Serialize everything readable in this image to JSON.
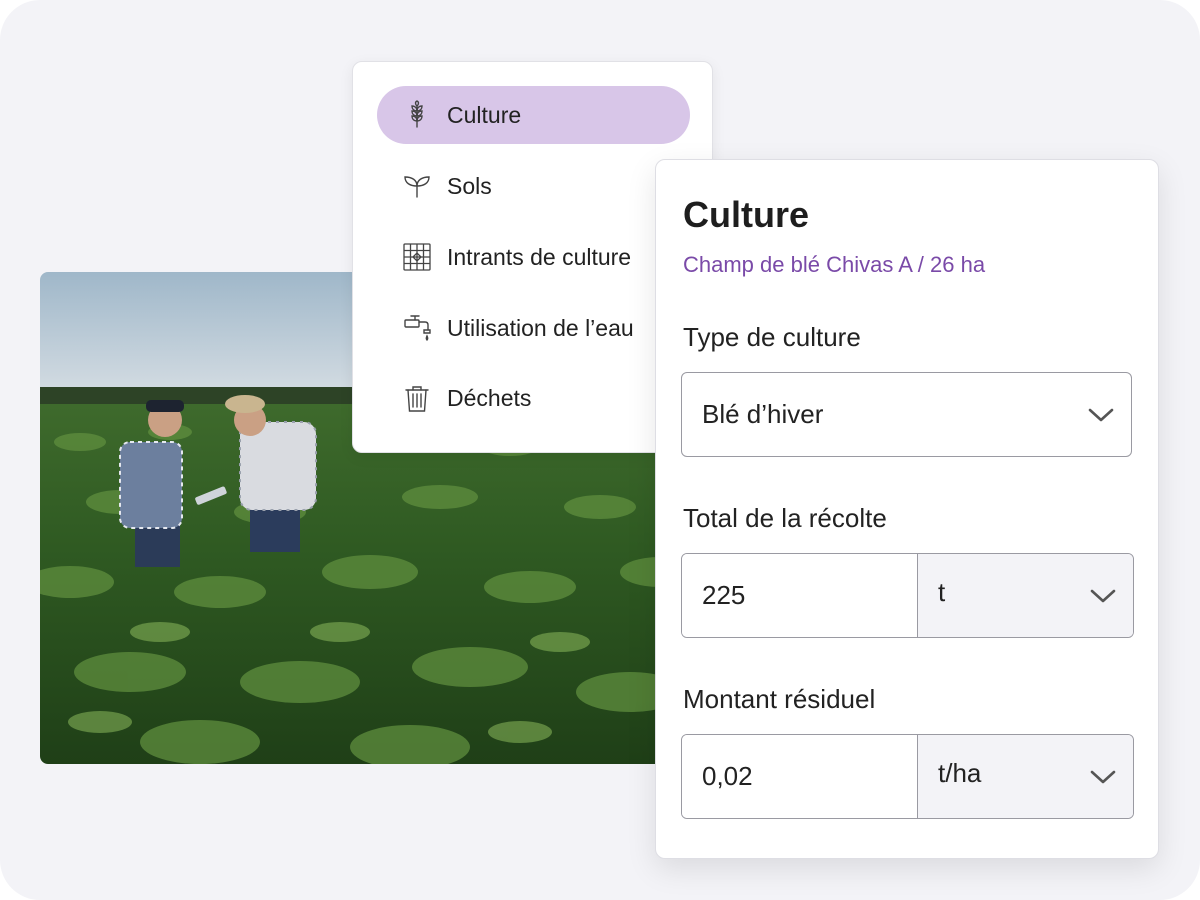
{
  "nav": {
    "items": [
      {
        "label": "Culture",
        "icon": "wheat-icon",
        "active": true
      },
      {
        "label": "Sols",
        "icon": "sprout-icon",
        "active": false
      },
      {
        "label": "Intrants de culture",
        "icon": "grid-icon",
        "active": false
      },
      {
        "label": "Utilisation de l’eau",
        "icon": "faucet-icon",
        "active": false
      },
      {
        "label": "Déchets",
        "icon": "trash-icon",
        "active": false
      }
    ]
  },
  "form": {
    "title": "Culture",
    "subtitle": "Champ de blé Chivas A / 26 ha",
    "crop_type": {
      "label": "Type de culture",
      "value": "Blé d’hiver"
    },
    "harvest_total": {
      "label": "Total de la récolte",
      "value": "225",
      "unit": "t"
    },
    "residual_amount": {
      "label": "Montant résiduel",
      "value": "0,02",
      "unit": "t/ha"
    }
  },
  "colors": {
    "accent": "#7a4aa8",
    "active_nav_bg": "#d8c6e8",
    "page_bg": "#f3f3f7"
  },
  "photo": {
    "description_icon": "field-photo"
  }
}
